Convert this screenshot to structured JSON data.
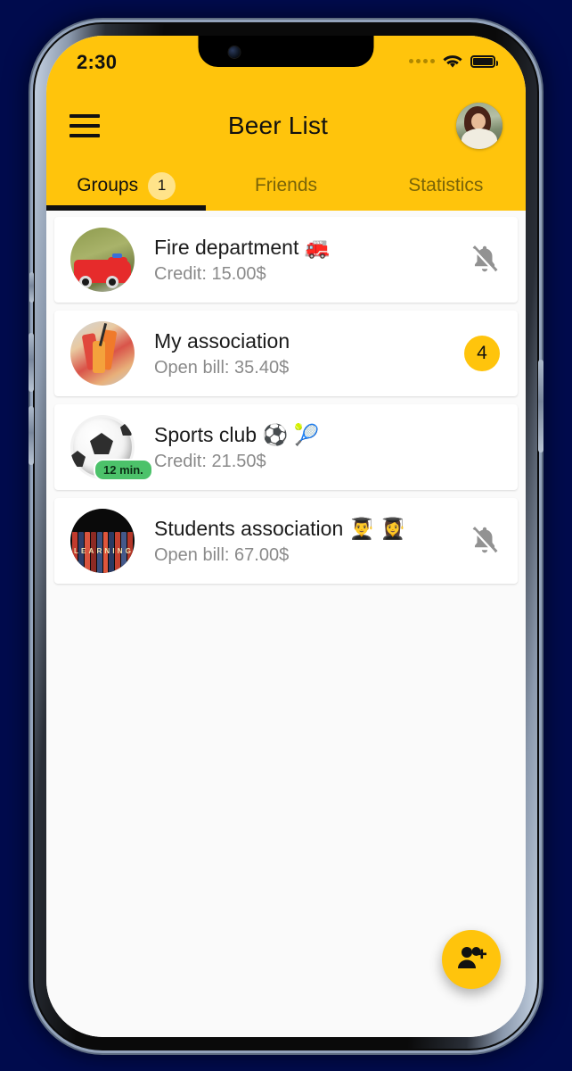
{
  "status_bar": {
    "time": "2:30",
    "signal_icon": "signal-dots-icon",
    "wifi_icon": "wifi-icon",
    "battery_icon": "battery-full-icon"
  },
  "app_bar": {
    "menu_icon": "hamburger-menu-icon",
    "title": "Beer List",
    "avatar_icon": "user-avatar"
  },
  "tabs": {
    "active_index": 0,
    "items": [
      {
        "label": "Groups",
        "badge": "1",
        "active": true
      },
      {
        "label": "Friends",
        "badge": "",
        "active": false
      },
      {
        "label": "Statistics",
        "badge": "",
        "active": false
      }
    ]
  },
  "groups": [
    {
      "title": "Fire department 🚒",
      "subtitle": "Credit: 15.00$",
      "avatar": "fire-truck-avatar",
      "trailing_type": "bell-off-icon",
      "trailing_value": "",
      "time_chip": ""
    },
    {
      "title": "My association",
      "subtitle": "Open bill: 35.40$",
      "avatar": "drinks-toast-avatar",
      "trailing_type": "count-badge",
      "trailing_value": "4",
      "time_chip": ""
    },
    {
      "title": "Sports club ⚽ 🎾",
      "subtitle": "Credit: 21.50$",
      "avatar": "soccer-ball-avatar",
      "trailing_type": "none",
      "trailing_value": "",
      "time_chip": "12 min."
    },
    {
      "title": "Students association 👨‍🎓 👩‍🎓",
      "subtitle": "Open bill: 67.00$",
      "avatar": "books-learning-avatar",
      "trailing_type": "bell-off-icon",
      "trailing_value": "",
      "time_chip": ""
    }
  ],
  "fab": {
    "icon": "add-person-icon",
    "label": ""
  },
  "colors": {
    "brand_yellow": "#FFC40C",
    "badge_yellow_light": "#FFE38A",
    "page_background": "#000B4D",
    "content_background": "#FAFAFA",
    "card_background": "#FFFFFF",
    "primary_text": "#1B1B1B",
    "secondary_text": "#8A8A8A",
    "green_chip": "#4CC26A"
  }
}
